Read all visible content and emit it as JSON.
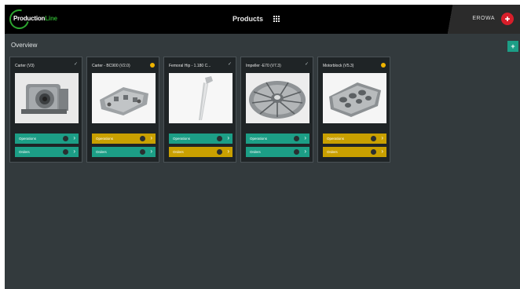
{
  "header": {
    "logo_part1": "Production",
    "logo_part2": "Line",
    "center_title": "Products",
    "brand": "EROWA",
    "brand_badge_icon": "erowa-logo-icon"
  },
  "page": {
    "title": "Overview",
    "add_label": "+"
  },
  "cards": [
    {
      "title": "Carter (V3)",
      "status": "check",
      "ops_label": "Operations",
      "ops_color": "teal",
      "orders_label": "Orders",
      "orders_color": "teal"
    },
    {
      "title": "Carter - BC900 (V2.0)",
      "status": "warning",
      "ops_label": "Operations",
      "ops_color": "gold",
      "orders_label": "Orders",
      "orders_color": "teal"
    },
    {
      "title": "Femoral Hip - 1.180 C...",
      "status": "check",
      "ops_label": "Operations",
      "ops_color": "teal",
      "orders_label": "Orders",
      "orders_color": "gold"
    },
    {
      "title": "Impeller -E70 (V7.3)",
      "status": "check",
      "ops_label": "Operations",
      "ops_color": "teal",
      "orders_label": "Orders",
      "orders_color": "teal"
    },
    {
      "title": "Motorblock (V5.3)",
      "status": "warning",
      "ops_label": "Operations",
      "ops_color": "gold",
      "orders_label": "Orders",
      "orders_color": "gold"
    }
  ],
  "colors": {
    "background": "#333a3d",
    "accent_green": "#2ca52f",
    "teal": "#1c9e86",
    "gold": "#c9a000",
    "warning": "#f0b400"
  }
}
